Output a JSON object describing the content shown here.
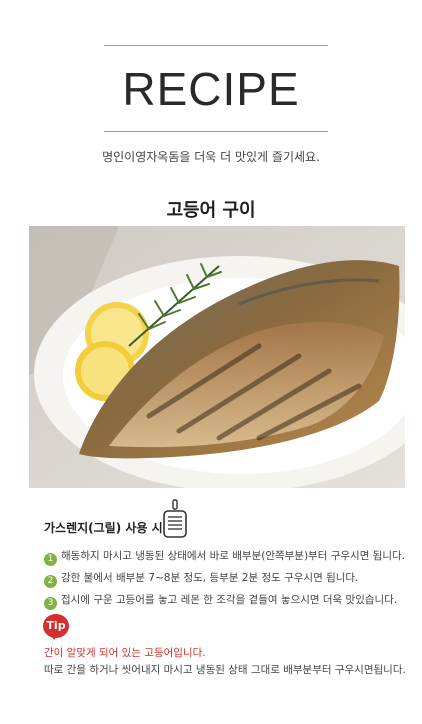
{
  "header": {
    "logo": "RECIPE",
    "subtitle": "명인이영자옥돔을 더욱 더 맛있게 즐기세요."
  },
  "dish": {
    "title": "고등어 구이"
  },
  "photo": {
    "icon": "grilled-mackerel-photo"
  },
  "method": {
    "label": "가스렌지(그릴) 사용 시",
    "icon": "grill-pan-icon",
    "steps": [
      {
        "num": "1",
        "text": "해동하지 마시고 냉동된 상태에서 바로 배부분(안쪽부분)부터 구우시면 됩니다."
      },
      {
        "num": "2",
        "text": "강한 불에서 배부분 7~8분 정도, 등부분 2분 정도 구우시면 됩니다."
      },
      {
        "num": "3",
        "text": "접시에 구운 고등어를 놓고 레몬 한 조각을 곁들여 놓으시면 더욱 맛있습니다."
      }
    ],
    "step_color": "#7fb241"
  },
  "tip": {
    "badge": "Tip",
    "badge_color": "#d62d2d",
    "highlight": "간이 알맞게 되어 있는 고등어입니다.",
    "text": "따로 간을 하거나 씻어내지 마시고 냉동된 상태 그대로 배부분부터 구우시면됩니다."
  }
}
